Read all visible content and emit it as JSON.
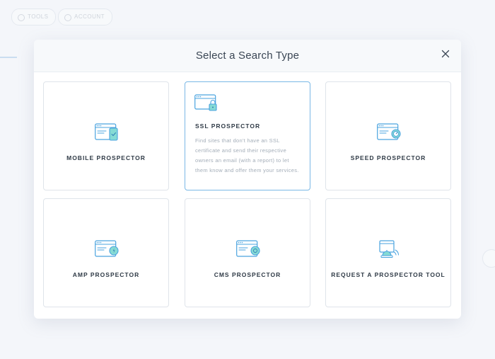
{
  "background": {
    "pills": [
      "TOOLS",
      "ACCOUNT"
    ]
  },
  "modal": {
    "title": "Select a Search Type",
    "cards": [
      {
        "label": "MOBILE PROSPECTOR",
        "icon": "mobile-browser-icon"
      },
      {
        "label": "SSL PROSPECTOR",
        "icon": "ssl-lock-browser-icon",
        "description": "Find sites that don't have an SSL certificate and send their respective owners an email (with a report) to let them know and offer them your services.",
        "selected": true
      },
      {
        "label": "SPEED PROSPECTOR",
        "icon": "speed-browser-icon"
      },
      {
        "label": "AMP PROSPECTOR",
        "icon": "amp-browser-icon"
      },
      {
        "label": "CMS PROSPECTOR",
        "icon": "cms-browser-icon"
      },
      {
        "label": "REQUEST A PROSPECTOR TOOL",
        "icon": "request-tool-icon"
      }
    ]
  },
  "colors": {
    "accent": "#4aa3df",
    "icon_teal": "#86dbd4",
    "selected_border": "#7ab8e6"
  }
}
